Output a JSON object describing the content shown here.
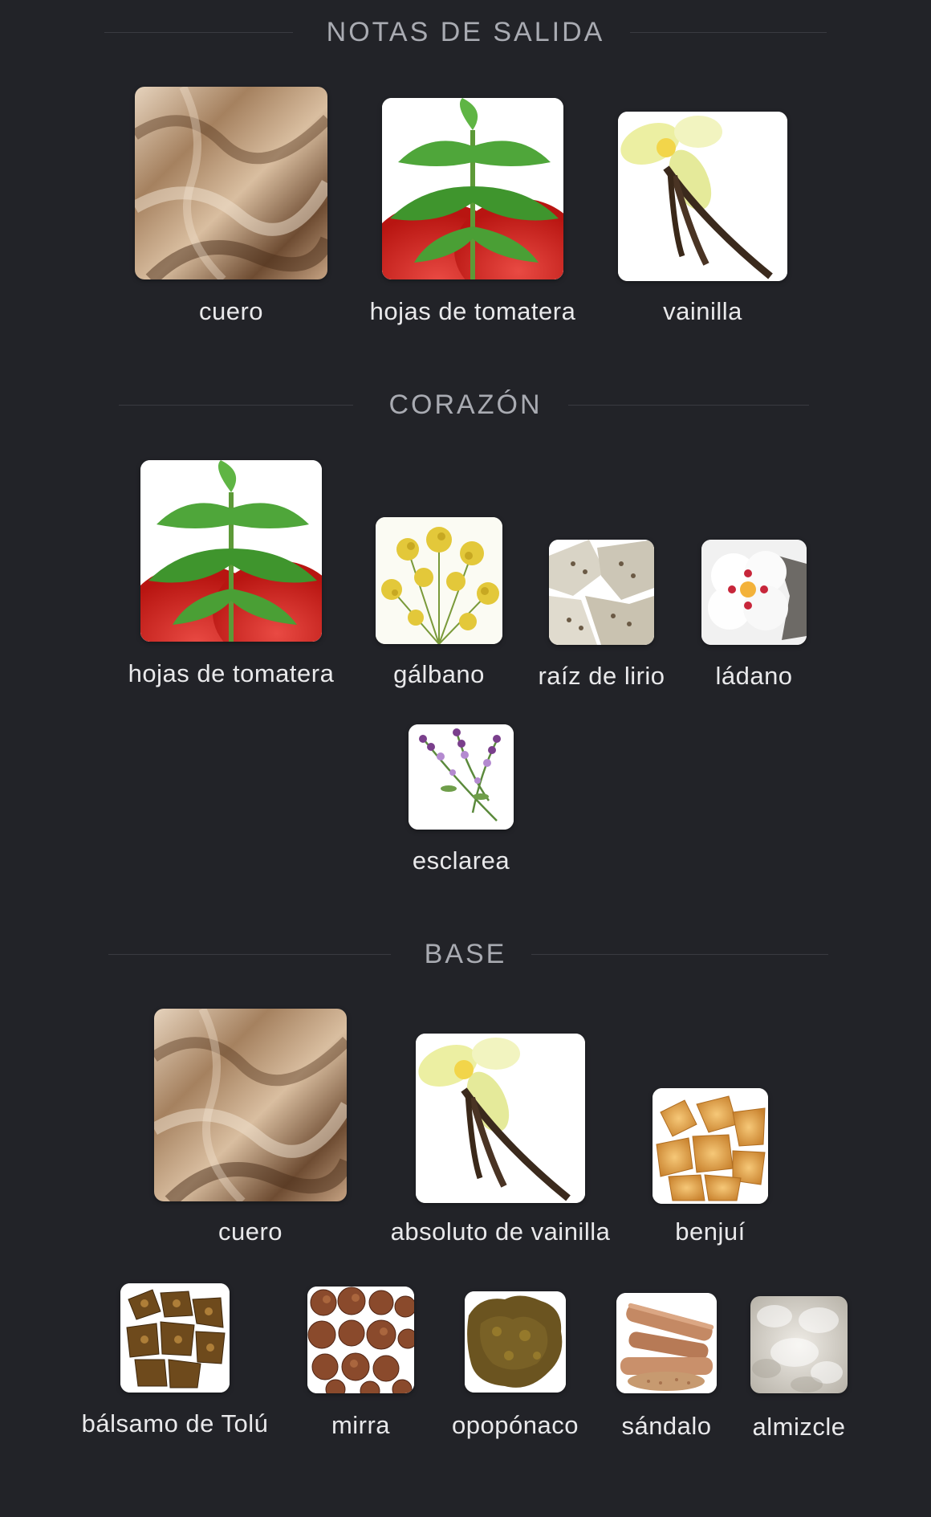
{
  "sections": {
    "top": {
      "title": "NOTAS DE SALIDA"
    },
    "heart": {
      "title": "CORAZÓN"
    },
    "base": {
      "title": "BASE"
    }
  },
  "notes": {
    "top_1": {
      "label": "cuero",
      "icon": "leather-image"
    },
    "top_2": {
      "label": "hojas de tomatera",
      "icon": "tomato-leaves-image"
    },
    "top_3": {
      "label": "vainilla",
      "icon": "vanilla-image"
    },
    "heart_1": {
      "label": "hojas de tomatera",
      "icon": "tomato-leaves-image"
    },
    "heart_2": {
      "label": "gálbano",
      "icon": "galbanum-image"
    },
    "heart_3": {
      "label": "raíz de lirio",
      "icon": "orris-root-image"
    },
    "heart_4": {
      "label": "ládano",
      "icon": "labdanum-image"
    },
    "heart_5": {
      "label": "esclarea",
      "icon": "clary-sage-image"
    },
    "base_1": {
      "label": "cuero",
      "icon": "leather-image"
    },
    "base_2": {
      "label": "absoluto de vainilla",
      "icon": "vanilla-image"
    },
    "base_3": {
      "label": "benjuí",
      "icon": "benzoin-image"
    },
    "base_4": {
      "label": "bálsamo de Tolú",
      "icon": "tolu-balsam-image"
    },
    "base_5": {
      "label": "mirra",
      "icon": "myrrh-image"
    },
    "base_6": {
      "label": "opopónaco",
      "icon": "opoponax-image"
    },
    "base_7": {
      "label": "sándalo",
      "icon": "sandalwood-image"
    },
    "base_8": {
      "label": "almizcle",
      "icon": "musk-image"
    }
  },
  "colors": {
    "background": "#222328",
    "section_title": "#a9abb2",
    "label": "#e9e9eb"
  }
}
